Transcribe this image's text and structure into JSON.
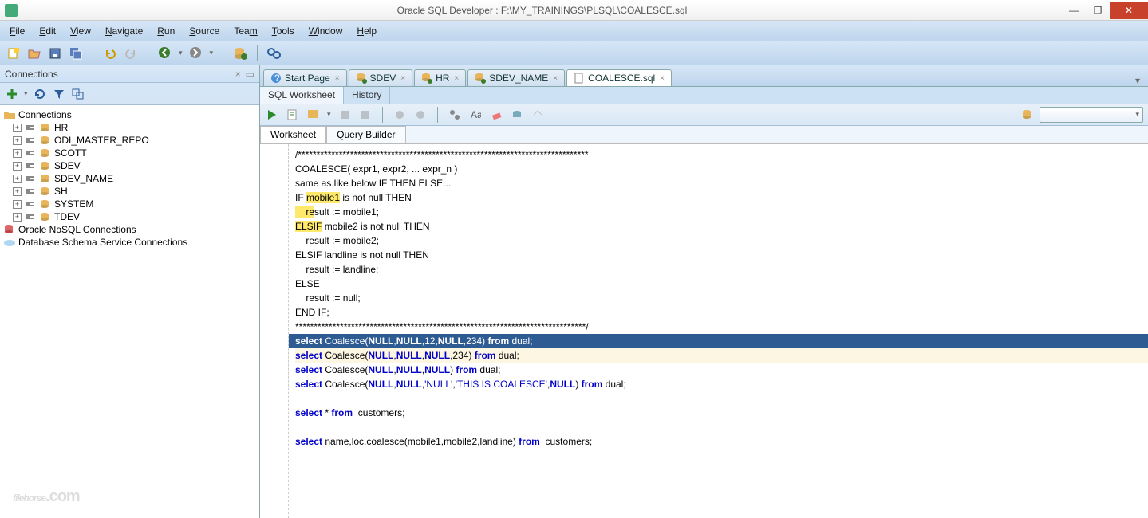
{
  "titlebar": {
    "title": "Oracle SQL Developer : F:\\MY_TRAININGS\\PLSQL\\COALESCE.sql"
  },
  "menu": [
    "File",
    "Edit",
    "View",
    "Navigate",
    "Run",
    "Source",
    "Team",
    "Tools",
    "Window",
    "Help"
  ],
  "sidebar": {
    "title": "Connections",
    "root": "Connections",
    "items": [
      "HR",
      "ODI_MASTER_REPO",
      "SCOTT",
      "SDEV",
      "SDEV_NAME",
      "SH",
      "SYSTEM",
      "TDEV"
    ],
    "extra": [
      "Oracle NoSQL Connections",
      "Database Schema Service Connections"
    ]
  },
  "tabs": [
    {
      "label": "Start Page",
      "icon": "question"
    },
    {
      "label": "SDEV",
      "icon": "db"
    },
    {
      "label": "HR",
      "icon": "db"
    },
    {
      "label": "SDEV_NAME",
      "icon": "db"
    },
    {
      "label": "COALESCE.sql",
      "icon": "sql",
      "active": true
    }
  ],
  "subtabs": {
    "a": "SQL Worksheet",
    "b": "History"
  },
  "wstabs": {
    "a": "Worksheet",
    "b": "Query Builder"
  },
  "code": {
    "l1": "/******************************************************************************",
    "l2": "COALESCE( expr1, expr2, ... expr_n )",
    "l3": "same as like below IF THEN ELSE...",
    "l4a": "IF ",
    "l4b": "mobile1",
    "l4c": " is not null THEN",
    "l5a": "    re",
    "l5b": "sult",
    "l5c": " := mobile1;",
    "l6a": "ELSIF",
    "l6b": " mobile2 is not null THEN",
    "l7": "    result := mobile2;",
    "l8": "ELSIF landline is not null THEN",
    "l9": "    result := landline;",
    "l10": "ELSE",
    "l11": "    result := null;",
    "l12": "END IF;",
    "l13": "******************************************************************************/",
    "l14pre": "select",
    "l14a": " Coalesce(",
    "l14n": "NULL",
    "l14c": ",",
    "l14v1": "12",
    "l14v2": "234",
    "l14b": ") ",
    "l14from": "from",
    "l14d": " dual;",
    "l15pre": "select",
    "l15a": " Coalesce(",
    "l15b": ") ",
    "l16pre": "select",
    "l16a": " Coalesce(",
    "l17pre": "select",
    "l17a": " Coalesce(",
    "l17s1": "'NULL'",
    "l17s2": "'THIS IS COALESCE'",
    "l18pre": "select",
    "l18a": " * ",
    "l18from": "from",
    "l18b": "  customers;",
    "l19pre": "select",
    "l19a": " name,loc,coalesce(mobile1,mobile2,landline) ",
    "l19from": "from",
    "l19b": "  customers;"
  },
  "watermark": "filehorse",
  "watermark_suffix": ".com"
}
